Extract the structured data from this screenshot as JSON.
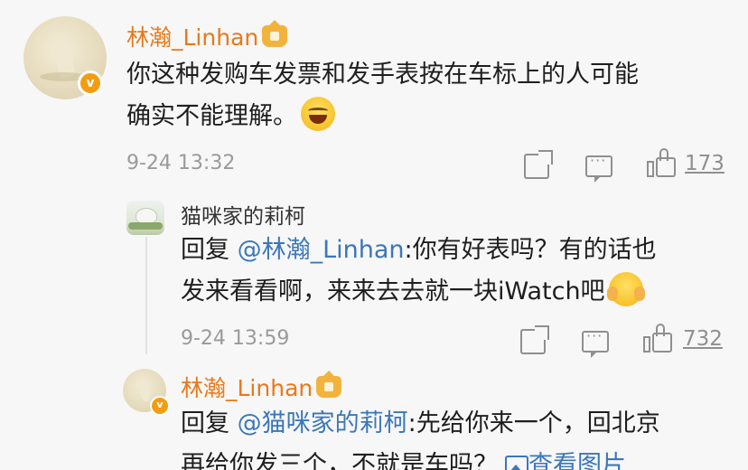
{
  "comment": {
    "author": "林瀚_Linhan",
    "text_line1": "你这种发购车发票和发手表按在车标上的人可能",
    "text_line2": "确实不能理解。",
    "time": "9-24 13:32",
    "like_count": "173",
    "verified_badge": "v"
  },
  "replies": [
    {
      "author": "猫咪家的莉柯",
      "reply_prefix": "回复",
      "mention": "@林瀚_Linhan",
      "text_line1": ":你有好表吗？有的话也",
      "text_line2": "发来看看啊，来来去去就一块iWatch吧",
      "time": "9-24 13:59",
      "like_count": "732"
    },
    {
      "author": "林瀚_Linhan",
      "reply_prefix": "回复",
      "mention": "@猫咪家的莉柯",
      "text_line1": ":先给你来一个，回北京",
      "text_line2": "再给你发三个，不就是车吗？",
      "view_image_label": "查看图片",
      "verified_badge": "v"
    }
  ],
  "icons": {
    "forward": "forward-icon",
    "comment": "comment-icon",
    "like": "like-icon",
    "crown": "vip-crown-icon",
    "laugh": "laugh-emoji",
    "cover_face": "cover-face-emoji",
    "image": "image-icon"
  },
  "colors": {
    "name_orange": "#e8791a",
    "mention_blue": "#3b77b9",
    "meta_gray": "#9a9a9a",
    "verified_orange": "#f39c12"
  }
}
